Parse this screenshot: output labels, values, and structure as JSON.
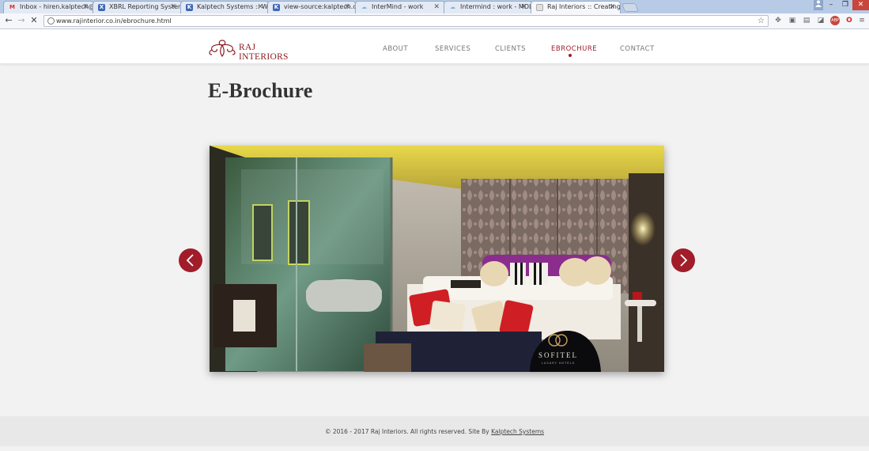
{
  "browser": {
    "tabs": [
      {
        "title": "Inbox - hiren.kalptech@g",
        "icon": "gmail-icon",
        "color": "#d93025",
        "glyph": "M"
      },
      {
        "title": "XBRL Reporting System",
        "icon": "xbrl-icon",
        "color": "#3f68b3",
        "glyph": "X"
      },
      {
        "title": "Kalptech Systems :: Work",
        "icon": "kalptech-icon",
        "color": "#3f68b3",
        "glyph": "K"
      },
      {
        "title": "view-source:kalptech.co",
        "icon": "kalptech-icon",
        "color": "#3f68b3",
        "glyph": "K"
      },
      {
        "title": "InterMind - work",
        "icon": "cloud-icon",
        "color": "#7ab9d6",
        "glyph": "☁"
      },
      {
        "title": "Intermind : work - MDL",
        "icon": "cloud-icon",
        "color": "#7ab9d6",
        "glyph": "☁"
      },
      {
        "title": "Raj Interiors :: Creating In",
        "icon": "page-icon",
        "color": "#bbbbbb",
        "glyph": ""
      }
    ],
    "url": "www.rajinterior.co.in/ebrochure.html",
    "window_controls": [
      "–",
      "❐",
      "✕"
    ]
  },
  "site": {
    "brand": "RAJ INTERIORS",
    "nav": [
      "ABOUT",
      "SERVICES",
      "CLIENTS",
      "EBROCHURE",
      "CONTACT"
    ],
    "active_nav": "EBROCHURE",
    "accent": "#a11d2a",
    "page_title": "E-Brochure",
    "slide_brand": "SOFITEL",
    "slide_brand_sub": "LUXURY HOTELS",
    "footer_text": "© 2016 - 2017 Raj Interiors. All rights reserved. Site By ",
    "footer_link": "Kalptech Systems"
  }
}
